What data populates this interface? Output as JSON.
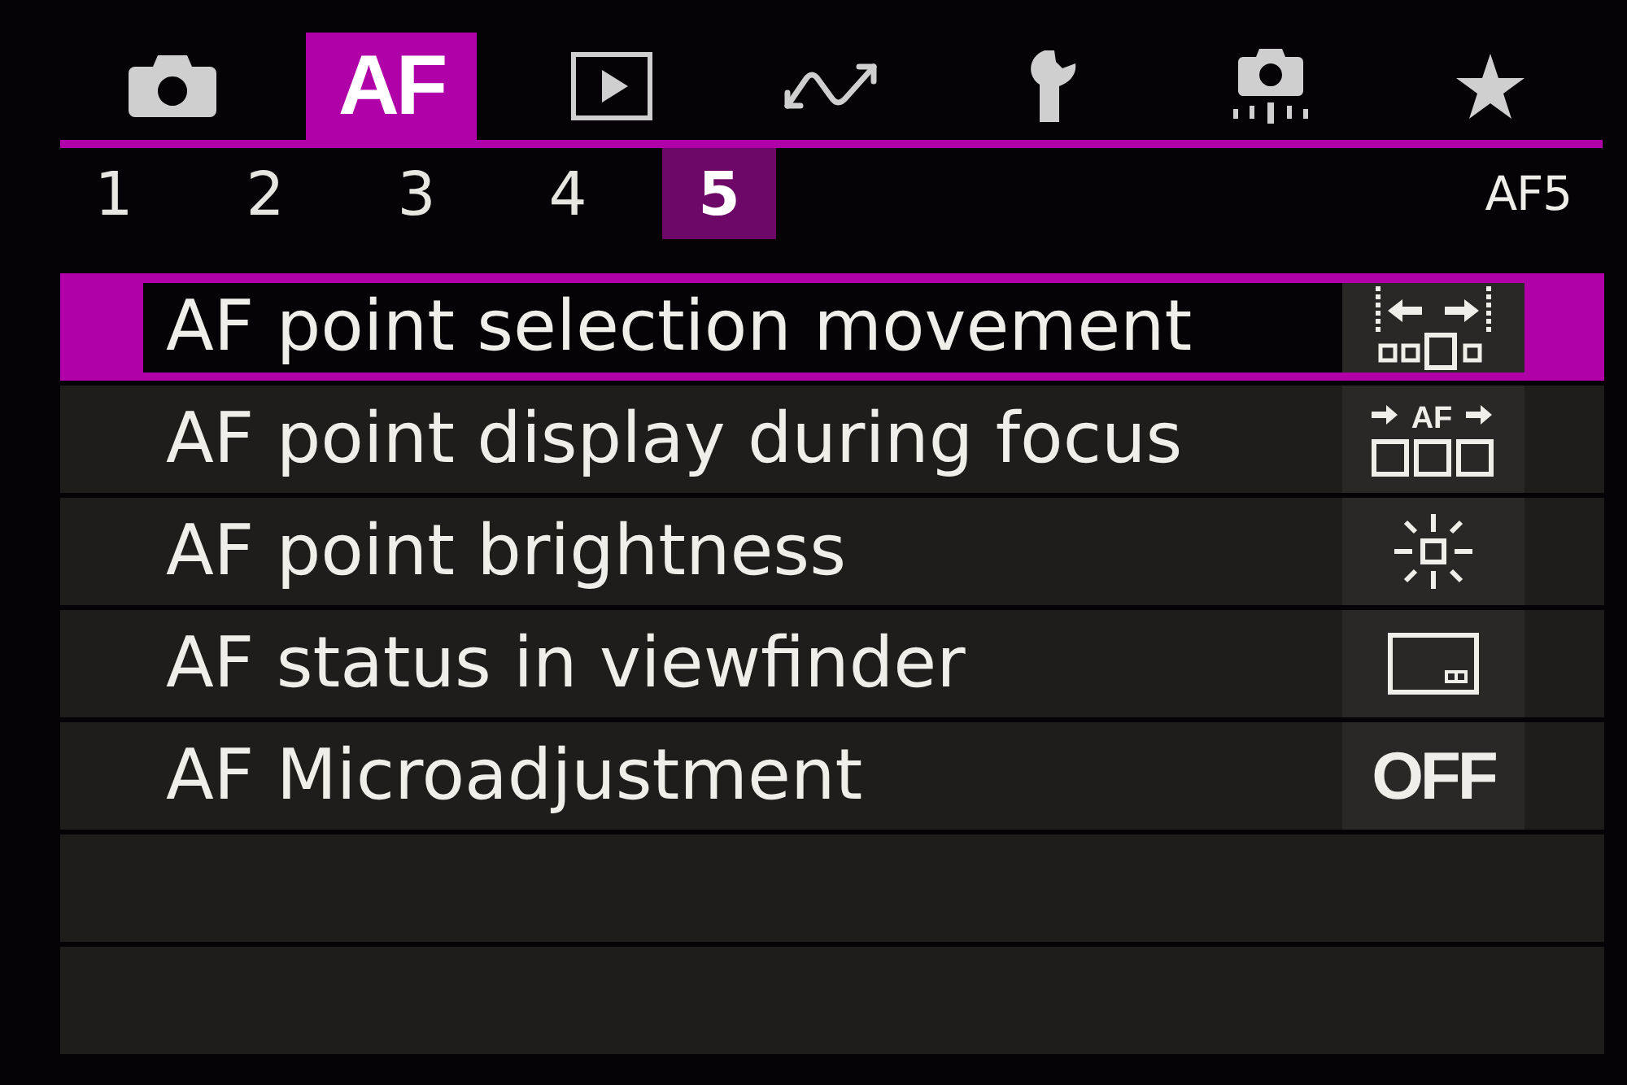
{
  "tabs": [
    {
      "kind": "camera",
      "selected": false
    },
    {
      "kind": "text",
      "label": "AF",
      "selected": true
    },
    {
      "kind": "playback",
      "selected": false
    },
    {
      "kind": "wave",
      "selected": false
    },
    {
      "kind": "wrench",
      "selected": false
    },
    {
      "kind": "cleaning",
      "selected": false
    },
    {
      "kind": "star",
      "selected": false
    }
  ],
  "subtabs": [
    {
      "label": "1",
      "selected": false
    },
    {
      "label": "2",
      "selected": false
    },
    {
      "label": "3",
      "selected": false
    },
    {
      "label": "4",
      "selected": false
    },
    {
      "label": "5",
      "selected": true
    }
  ],
  "page_label": "AF5",
  "items": [
    {
      "label": "AF point selection movement",
      "selected": true,
      "value": {
        "kind": "movement"
      }
    },
    {
      "label": "AF point display during focus",
      "selected": false,
      "value": {
        "kind": "display",
        "text": "AF"
      }
    },
    {
      "label": "AF point brightness",
      "selected": false,
      "value": {
        "kind": "brightness"
      }
    },
    {
      "label": "AF status in viewfinder",
      "selected": false,
      "value": {
        "kind": "status"
      }
    },
    {
      "label": "AF Microadjustment",
      "selected": false,
      "value": {
        "kind": "text",
        "text": "OFF"
      }
    }
  ]
}
